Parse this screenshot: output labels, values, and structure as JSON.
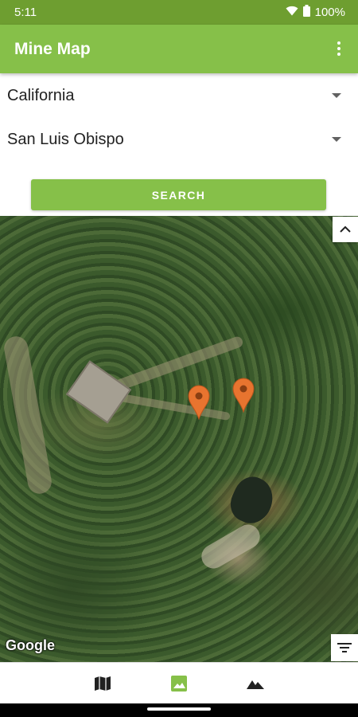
{
  "status_bar": {
    "time": "5:11",
    "battery": "100%",
    "icons": [
      "wifi-icon",
      "battery-icon"
    ]
  },
  "app_bar": {
    "title": "Mine Map",
    "menu_icon": "more-vert-icon"
  },
  "filters": {
    "state": {
      "selected": "California"
    },
    "county": {
      "selected": "San Luis Obispo"
    }
  },
  "search_button": {
    "label": "SEARCH"
  },
  "map": {
    "type": "satellite",
    "attribution": "Google",
    "markers": [
      {
        "name": "mine-marker-1",
        "color": "#e8742f"
      },
      {
        "name": "mine-marker-2",
        "color": "#e8742f"
      }
    ],
    "controls": [
      "collapse-up-icon",
      "filter-icon"
    ]
  },
  "bottom_nav": {
    "items": [
      {
        "icon": "map-icon",
        "active": false
      },
      {
        "icon": "satellite-image-icon",
        "active": true
      },
      {
        "icon": "terrain-icon",
        "active": false
      }
    ],
    "active_color": "#86c049",
    "inactive_color": "#212121"
  },
  "colors": {
    "primary": "#86c049",
    "primary_dark": "#6e9e30",
    "marker": "#e8742f"
  }
}
